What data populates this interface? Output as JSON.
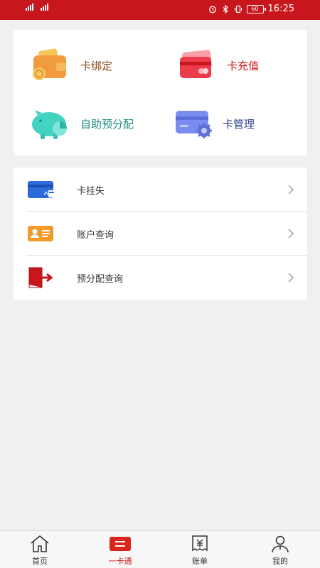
{
  "status_bar": {
    "network_1": "4G",
    "network_2": "4G",
    "battery": "60",
    "time": "16:25"
  },
  "grid": [
    {
      "label": "卡绑定",
      "icon": "wallet-icon",
      "color": "#8a4a12"
    },
    {
      "label": "卡充值",
      "icon": "card-recharge-icon",
      "color": "#c8161d"
    },
    {
      "label": "自助预分配",
      "icon": "piggy-bank-icon",
      "color": "#1f8a7e"
    },
    {
      "label": "卡管理",
      "icon": "card-settings-icon",
      "color": "#2c3e8c"
    }
  ],
  "list": [
    {
      "label": "卡挂失",
      "icon": "card-lost-icon"
    },
    {
      "label": "账户查询",
      "icon": "id-card-icon"
    },
    {
      "label": "预分配查询",
      "icon": "exit-door-icon"
    }
  ],
  "tabbar": {
    "items": [
      {
        "label": "首页",
        "icon": "home-icon"
      },
      {
        "label": "一卡通",
        "icon": "one-card-icon"
      },
      {
        "label": "账单",
        "icon": "bill-icon"
      },
      {
        "label": "我的",
        "icon": "profile-icon"
      }
    ],
    "active": "一卡通"
  }
}
